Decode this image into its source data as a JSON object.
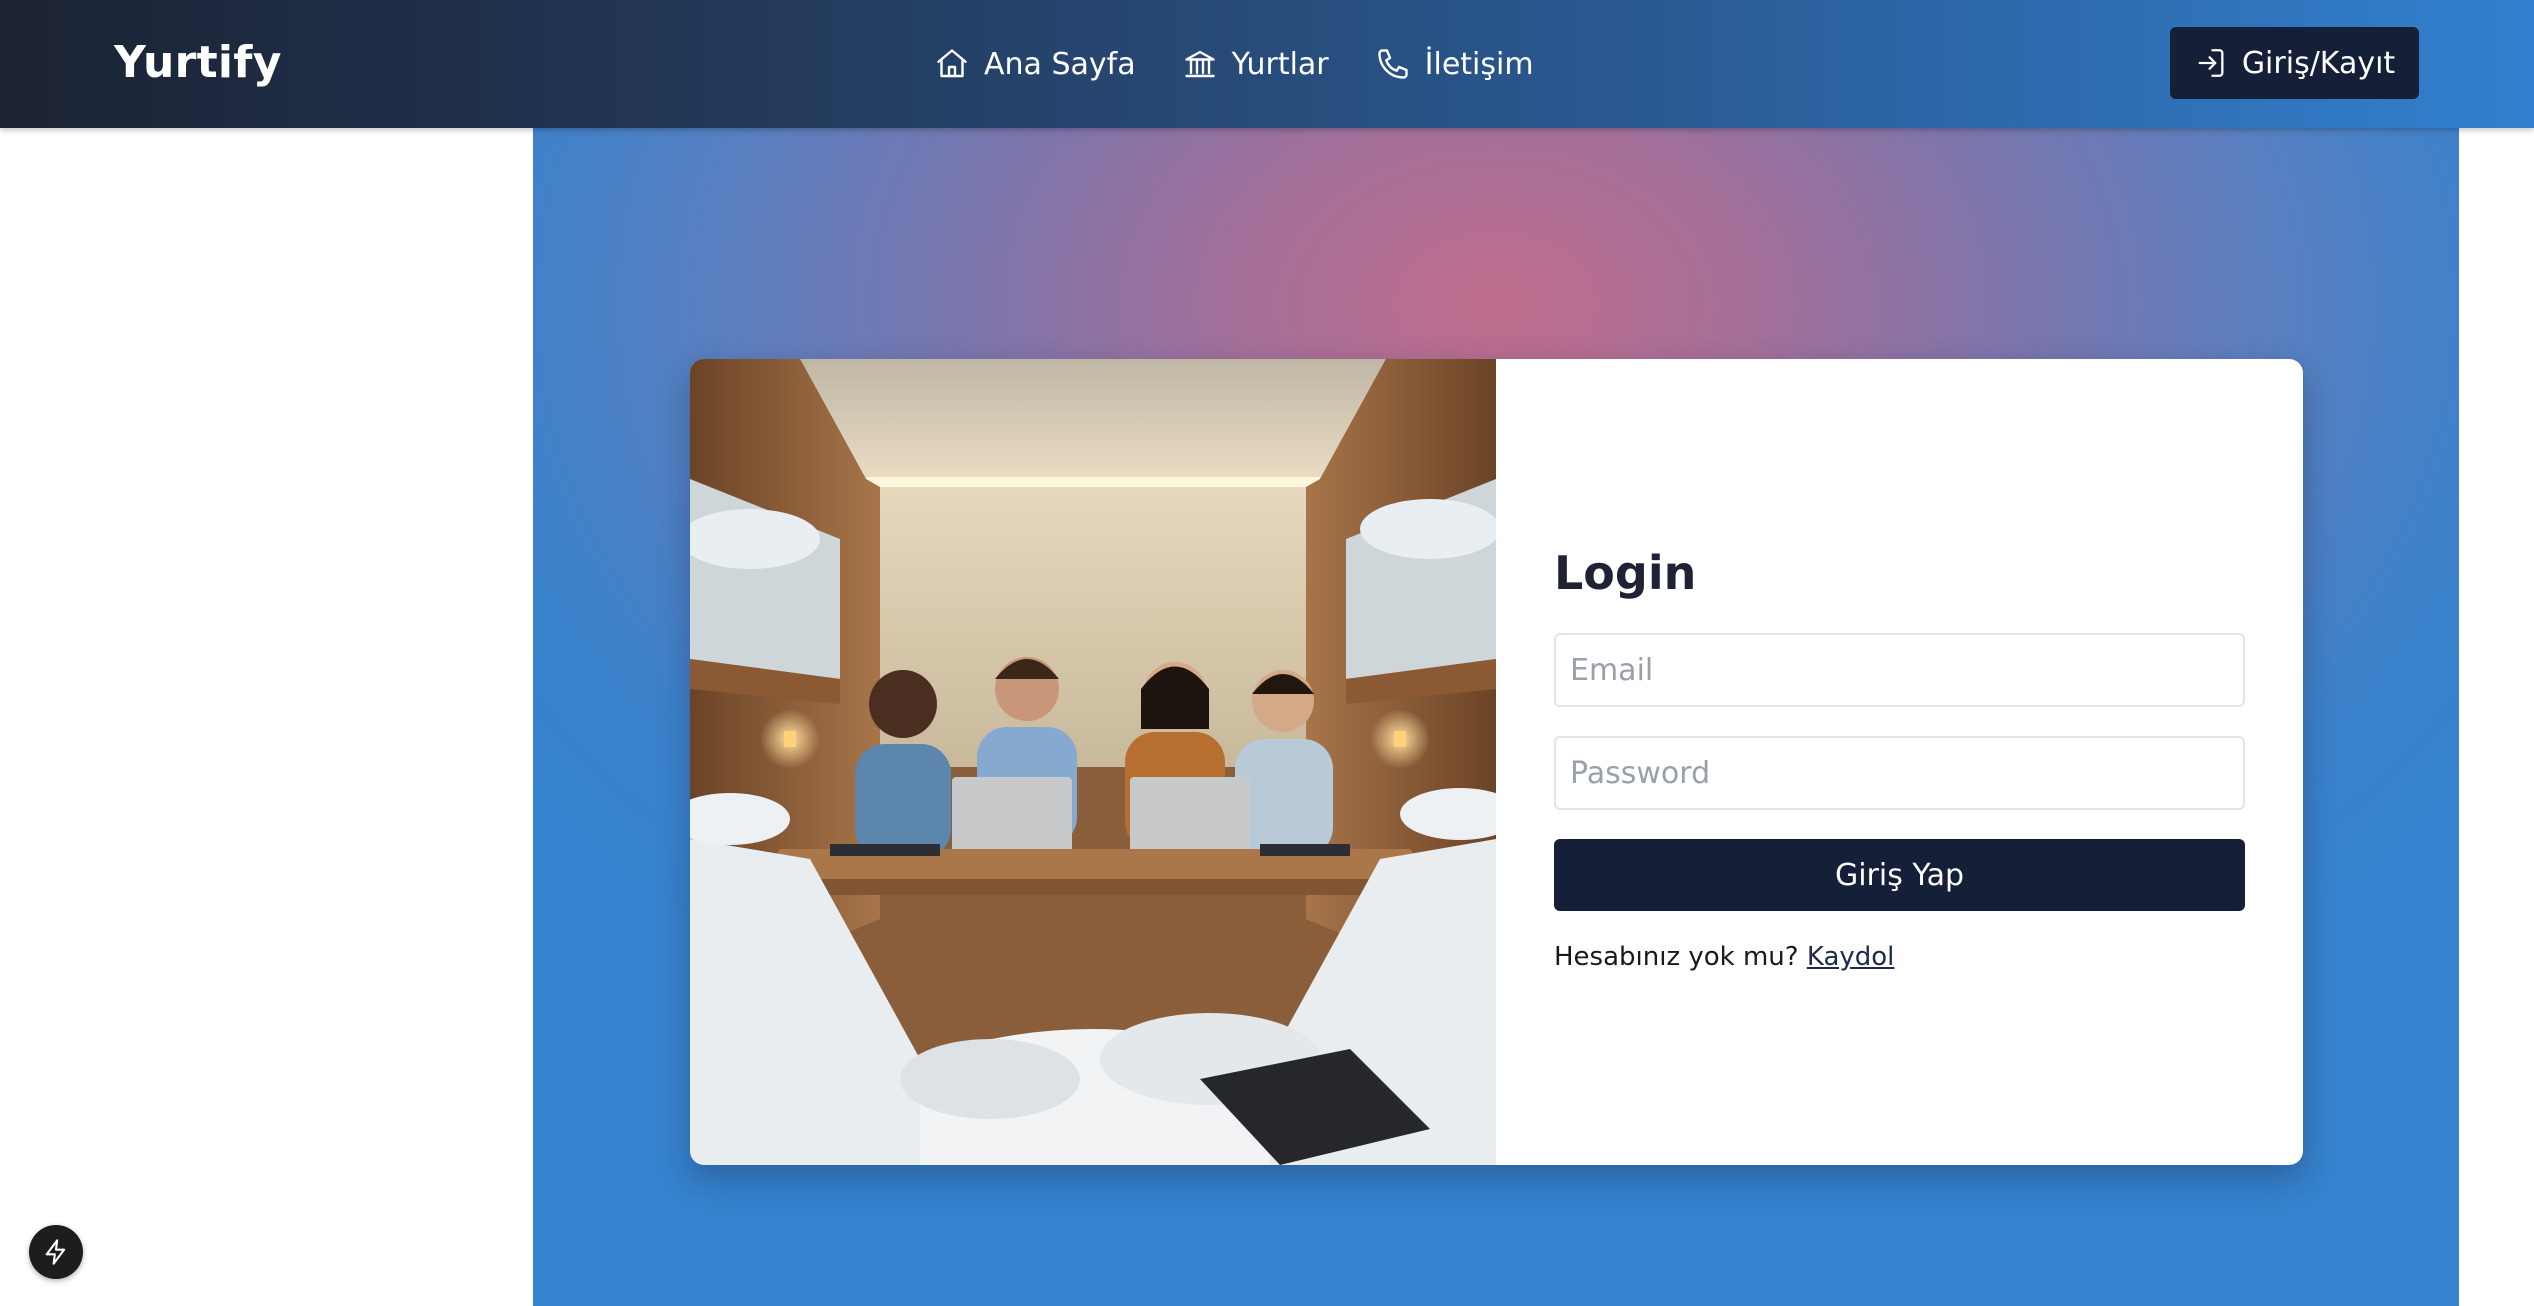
{
  "header": {
    "brand": "Yurtify",
    "nav": [
      {
        "label": "Ana Sayfa",
        "icon": "home-icon"
      },
      {
        "label": "Yurtlar",
        "icon": "building-icon"
      },
      {
        "label": "İletişim",
        "icon": "phone-icon"
      }
    ],
    "auth_button": {
      "label": "Giriş/Kayıt",
      "icon": "login-icon"
    }
  },
  "login": {
    "title": "Login",
    "email_placeholder": "Email",
    "password_placeholder": "Password",
    "submit_label": "Giriş Yap",
    "signup_prompt": "Hesabınız yok mu?",
    "signup_link": "Kaydol"
  },
  "hero_image": {
    "icon": "students-dorm-photo"
  },
  "fab": {
    "icon": "lightning-icon"
  },
  "colors": {
    "header_start": "#1b2233",
    "header_end": "#3280cf",
    "primary_button": "#161f38",
    "hero_center": "#c06d8c",
    "hero_edge": "#3683cf"
  }
}
